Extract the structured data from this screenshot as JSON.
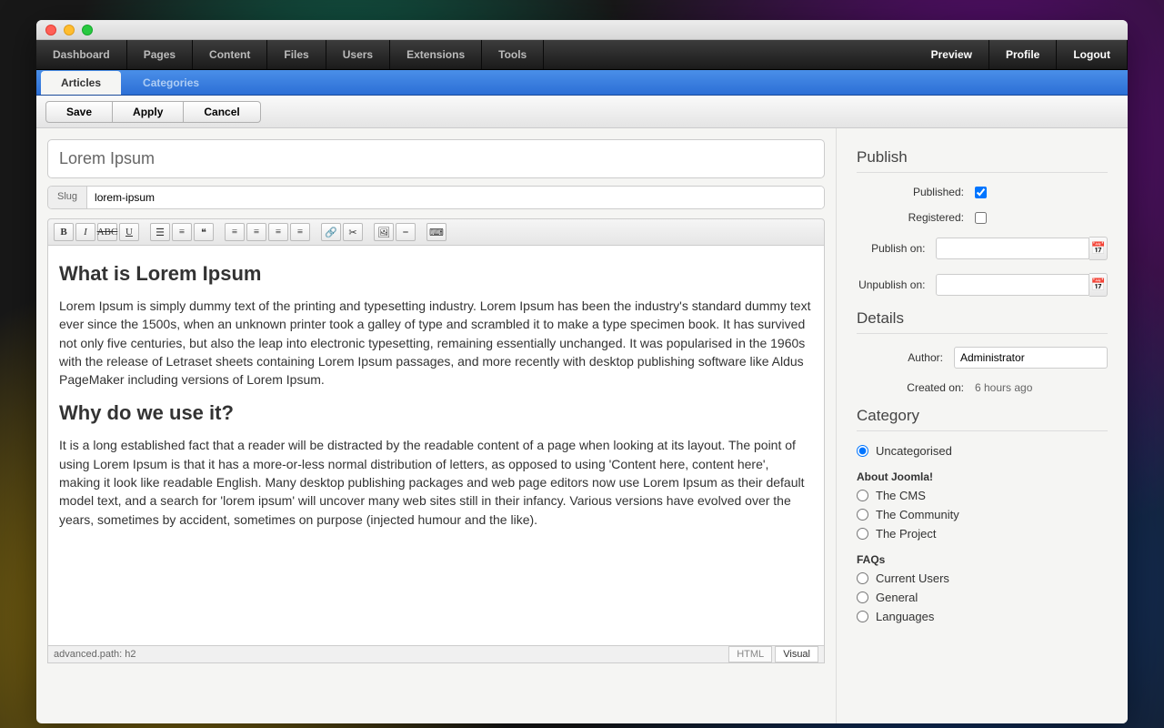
{
  "top_menu_left": [
    "Dashboard",
    "Pages",
    "Content",
    "Files",
    "Users",
    "Extensions",
    "Tools"
  ],
  "top_menu_right": [
    "Preview",
    "Profile",
    "Logout"
  ],
  "sub_tabs": {
    "active": "Articles",
    "other": "Categories"
  },
  "actions": {
    "save": "Save",
    "apply": "Apply",
    "cancel": "Cancel"
  },
  "article": {
    "title": "Lorem Ipsum",
    "slug_label": "Slug",
    "slug": "lorem-ipsum",
    "h1": "What is Lorem Ipsum",
    "p1": "Lorem Ipsum is simply dummy text of the printing and typesetting industry. Lorem Ipsum has been the industry's standard dummy text ever since the 1500s, when an unknown printer took a galley of type and scrambled it to make a type specimen book. It has survived not only five centuries, but also the leap into electronic typesetting, remaining essentially unchanged. It was popularised in the 1960s with the release of Letraset sheets containing Lorem Ipsum passages, and more recently with desktop publishing software like Aldus PageMaker including versions of Lorem Ipsum.",
    "h2": "Why do we use it?",
    "p2": "It is a long established fact that a reader will be distracted by the readable content of a page when looking at its layout. The point of using Lorem Ipsum is that it has a more-or-less normal distribution of letters, as opposed to using 'Content here, content here', making it look like readable English. Many desktop publishing packages and web page editors now use Lorem Ipsum as their default model text, and a search for 'lorem ipsum' will uncover many web sites still in their infancy. Various versions have evolved over the years, sometimes by accident, sometimes on purpose (injected humour and the like)."
  },
  "editor_status": {
    "path": "advanced.path: h2",
    "mode_html": "HTML",
    "mode_visual": "Visual"
  },
  "publish": {
    "heading": "Publish",
    "published_label": "Published:",
    "published": true,
    "registered_label": "Registered:",
    "registered": false,
    "publish_on_label": "Publish on:",
    "publish_on": "",
    "unpublish_on_label": "Unpublish on:",
    "unpublish_on": ""
  },
  "details": {
    "heading": "Details",
    "author_label": "Author:",
    "author": "Administrator",
    "created_label": "Created on:",
    "created": "6 hours ago"
  },
  "category": {
    "heading": "Category",
    "selected": "Uncategorised",
    "groups": [
      {
        "name": "About Joomla!",
        "items": [
          "The CMS",
          "The Community",
          "The Project"
        ]
      },
      {
        "name": "FAQs",
        "items": [
          "Current Users",
          "General",
          "Languages"
        ]
      }
    ]
  }
}
